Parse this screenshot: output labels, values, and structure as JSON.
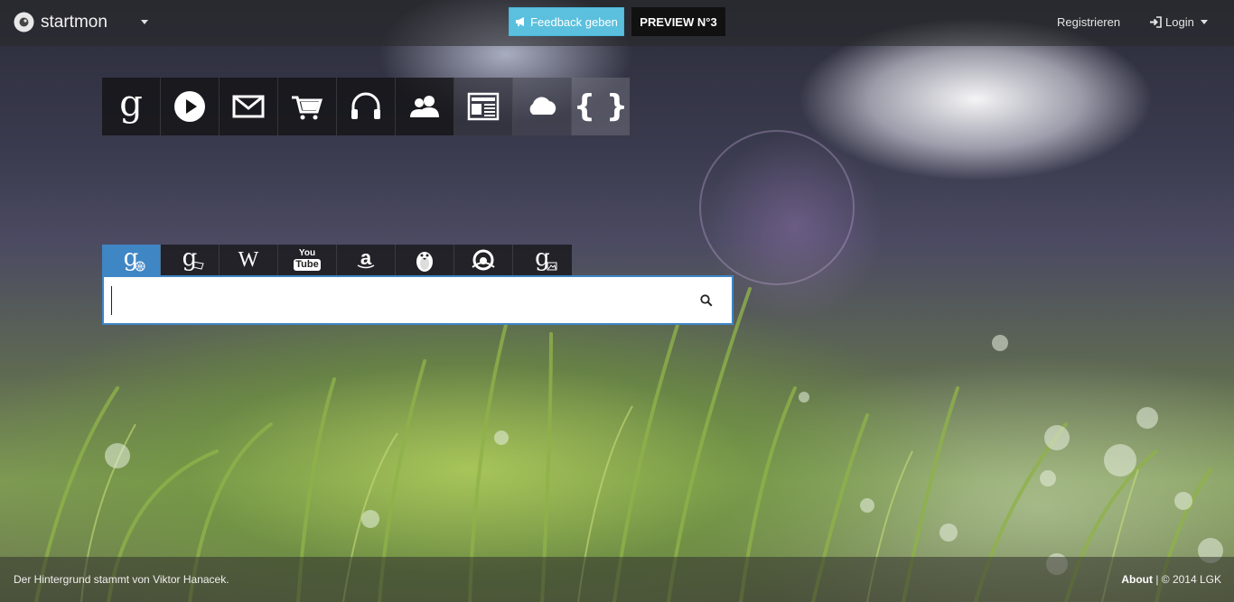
{
  "brand": {
    "name": "startmon",
    "logo_icon": "startmon-logo-icon"
  },
  "header": {
    "feedback_label": "Feedback geben",
    "preview_label": "PREVIEW N°3",
    "register_label": "Registrieren",
    "login_label": "Login"
  },
  "shortcuts": [
    {
      "icon": "google-icon"
    },
    {
      "icon": "play-icon"
    },
    {
      "icon": "mail-icon"
    },
    {
      "icon": "cart-icon"
    },
    {
      "icon": "headphones-icon"
    },
    {
      "icon": "users-icon"
    },
    {
      "icon": "news-icon"
    },
    {
      "icon": "cloud-icon"
    },
    {
      "icon": "code-braces-icon"
    }
  ],
  "engines": [
    {
      "icon": "google-web-icon",
      "active": true
    },
    {
      "icon": "google-translate-icon",
      "active": false
    },
    {
      "icon": "wikipedia-icon",
      "active": false
    },
    {
      "icon": "youtube-icon",
      "active": false
    },
    {
      "icon": "amazon-icon",
      "active": false
    },
    {
      "icon": "penguin-icon",
      "active": false
    },
    {
      "icon": "eye-icon",
      "active": false
    },
    {
      "icon": "google-images-icon",
      "active": false
    }
  ],
  "engine_text": {
    "wiki": "W",
    "yt_top": "You",
    "yt_bottom": "Tube",
    "amazon": "a",
    "g": "g",
    "braces": "{ }"
  },
  "search": {
    "value": "",
    "placeholder": ""
  },
  "footer": {
    "credit_prefix": "Der Hintergrund stammt von",
    "credit_author": "Viktor Hanacek.",
    "about_label": "About",
    "copyright": "| © 2014 LGK"
  },
  "colors": {
    "accent": "#3f86c5",
    "feedback": "#5bc0de",
    "preview": "#111111"
  }
}
